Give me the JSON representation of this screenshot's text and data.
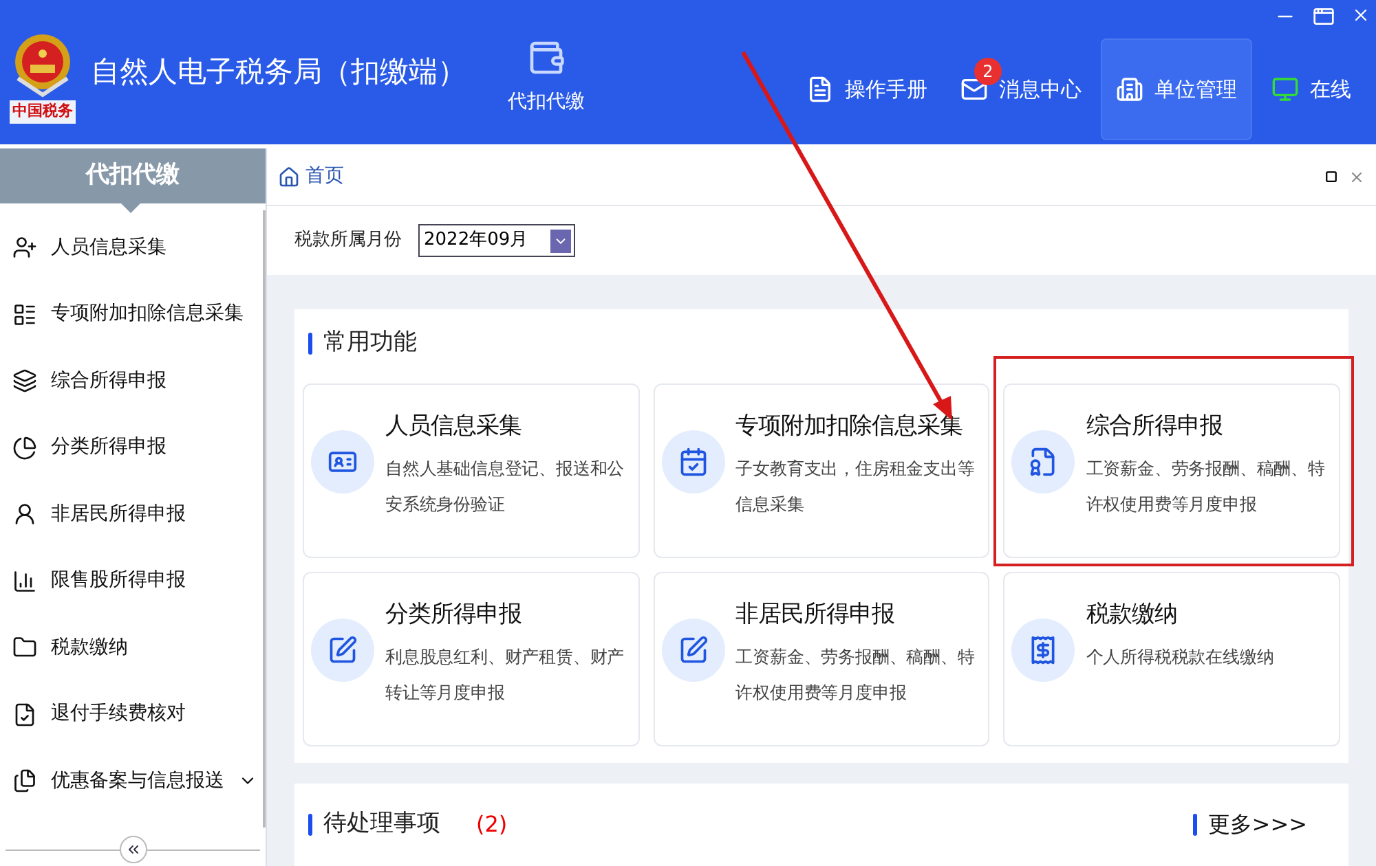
{
  "header": {
    "logo_text": "中国税务",
    "title": "自然人电子税务局（扣缴端）",
    "module": {
      "label": "代扣代缴"
    },
    "nav": [
      {
        "kind": "manual",
        "label": "操作手册",
        "selected": false
      },
      {
        "kind": "messages",
        "label": "消息中心",
        "badge": "2",
        "selected": false
      },
      {
        "kind": "unit",
        "label": "单位管理",
        "selected": true
      },
      {
        "kind": "online",
        "label": "在线",
        "selected": false
      }
    ]
  },
  "sidebar": {
    "title": "代扣代缴",
    "items": [
      {
        "label": "人员信息采集",
        "expandable": false
      },
      {
        "label": "专项附加扣除信息采集",
        "expandable": false
      },
      {
        "label": "综合所得申报",
        "expandable": false
      },
      {
        "label": "分类所得申报",
        "expandable": false
      },
      {
        "label": "非居民所得申报",
        "expandable": false
      },
      {
        "label": "限售股所得申报",
        "expandable": false
      },
      {
        "label": "税款缴纳",
        "expandable": false
      },
      {
        "label": "退付手续费核对",
        "expandable": false
      },
      {
        "label": "优惠备案与信息报送",
        "expandable": true
      }
    ]
  },
  "tab": {
    "label": "首页"
  },
  "period": {
    "label": "税款所属月份",
    "value": "2022年09月"
  },
  "common": {
    "title": "常用功能",
    "cards": [
      {
        "title": "人员信息采集",
        "desc": "自然人基础信息登记、报送和公安系统身份验证",
        "highlighted": false
      },
      {
        "title": "专项附加扣除信息采集",
        "desc": "子女教育支出，住房租金支出等信息采集",
        "highlighted": false
      },
      {
        "title": "综合所得申报",
        "desc": "工资薪金、劳务报酬、稿酬、特许权使用费等月度申报",
        "highlighted": true
      },
      {
        "title": "分类所得申报",
        "desc": "利息股息红利、财产租赁、财产转让等月度申报",
        "highlighted": false
      },
      {
        "title": "非居民所得申报",
        "desc": "工资薪金、劳务报酬、稿酬、特许权使用费等月度申报",
        "highlighted": false
      },
      {
        "title": "税款缴纳",
        "desc": "个人所得税税款在线缴纳",
        "highlighted": false
      }
    ]
  },
  "pending": {
    "title": "待处理事项",
    "count": "(2)",
    "more": "更多>>>"
  }
}
